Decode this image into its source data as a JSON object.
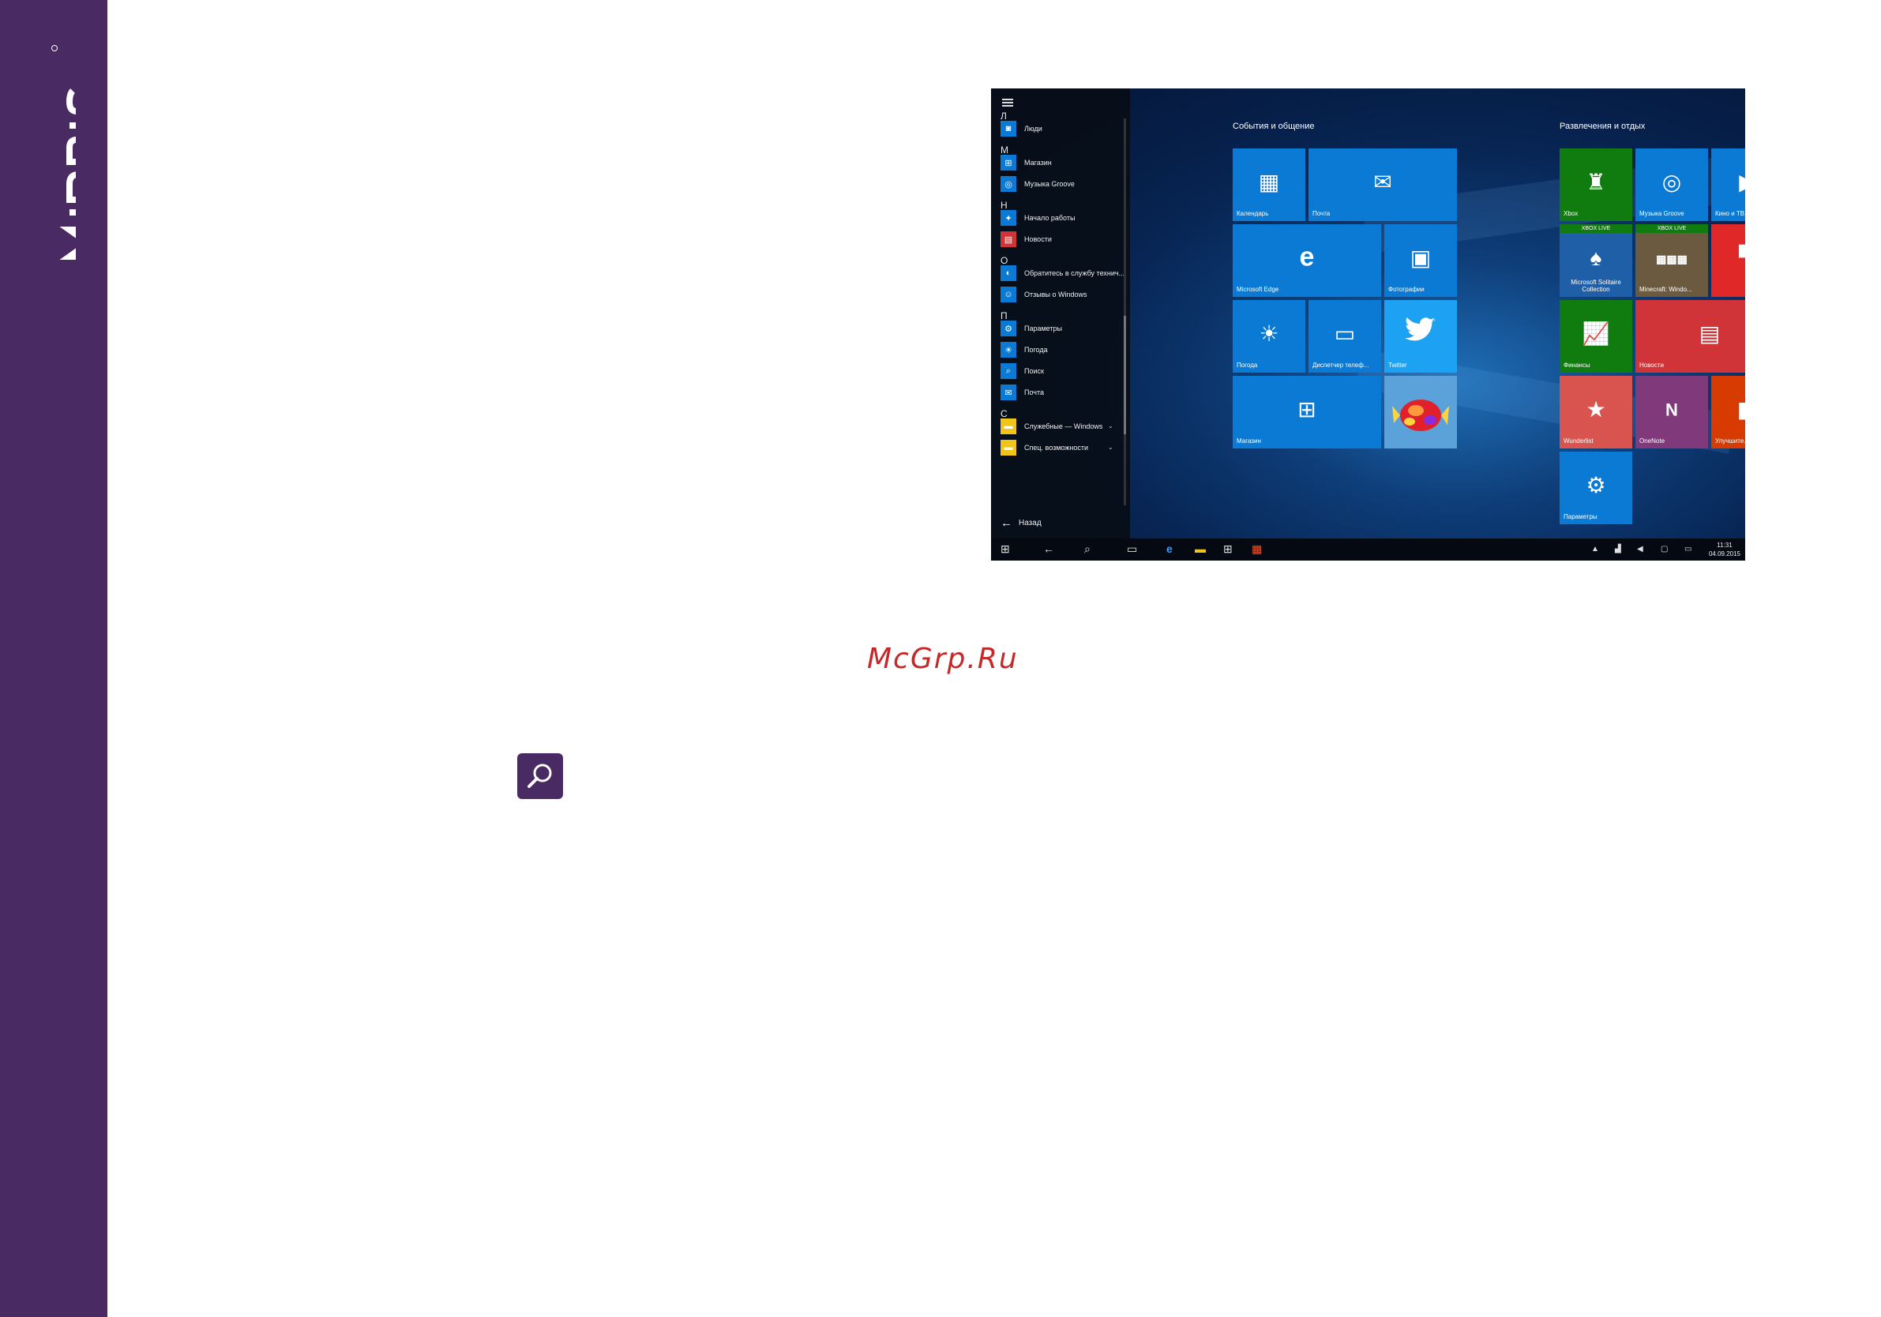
{
  "brand": {
    "name": "IRBIS",
    "color": "#4a2a63"
  },
  "start_menu": {
    "sections": [
      {
        "letter": "Л",
        "apps": [
          {
            "label": "Люди",
            "icon": "people-icon",
            "color": "#0a7ad4"
          }
        ]
      },
      {
        "letter": "М",
        "apps": [
          {
            "label": "Магазин",
            "icon": "store-icon",
            "color": "#0a7ad4"
          },
          {
            "label": "Музыка Groove",
            "icon": "groove-music-icon",
            "color": "#0a7ad4"
          }
        ]
      },
      {
        "letter": "Н",
        "apps": [
          {
            "label": "Начало работы",
            "icon": "get-started-icon",
            "color": "#0a7ad4"
          },
          {
            "label": "Новости",
            "icon": "news-icon",
            "color": "#d13438"
          }
        ]
      },
      {
        "letter": "О",
        "apps": [
          {
            "label": "Обратитесь в службу технич...",
            "icon": "contact-support-icon",
            "color": "#0a7ad4"
          },
          {
            "label": "Отзывы о Windows",
            "icon": "feedback-icon",
            "color": "#0a7ad4"
          }
        ]
      },
      {
        "letter": "П",
        "apps": [
          {
            "label": "Параметры",
            "icon": "settings-icon",
            "color": "#0a7ad4"
          },
          {
            "label": "Погода",
            "icon": "weather-icon",
            "color": "#0a7ad4"
          },
          {
            "label": "Поиск",
            "icon": "search-icon",
            "color": "#0a7ad4"
          },
          {
            "label": "Почта",
            "icon": "mail-icon",
            "color": "#0a7ad4"
          }
        ]
      },
      {
        "letter": "С",
        "apps": [
          {
            "label": "Служебные — Windows",
            "icon": "folder-icon",
            "color": "#f0c419",
            "expandable": true
          },
          {
            "label": "Спец. возможности",
            "icon": "folder-icon",
            "color": "#f0c419",
            "expandable": true
          }
        ]
      }
    ],
    "back_label": "Назад"
  },
  "groups": [
    {
      "title": "События и общение"
    },
    {
      "title": "Развлечения и отдых"
    }
  ],
  "tiles": {
    "calendar": {
      "label": "Календарь",
      "icon": "calendar-icon",
      "color": "#0a7ad4"
    },
    "mail": {
      "label": "Почта",
      "icon": "mail-icon",
      "color": "#0a7ad4"
    },
    "edge": {
      "label": "Microsoft Edge",
      "icon": "edge-icon",
      "color": "#0a7ad4"
    },
    "photos": {
      "label": "Фотографии",
      "icon": "photos-icon",
      "color": "#0a7ad4"
    },
    "weather": {
      "label": "Погода",
      "icon": "weather-icon",
      "color": "#0a7ad4"
    },
    "phone": {
      "label": "Диспетчер телеф...",
      "icon": "phone-companion-icon",
      "color": "#0a7ad4"
    },
    "twitter": {
      "label": "Twitter",
      "icon": "twitter-icon",
      "color": "#1da1f2"
    },
    "store": {
      "label": "Магазин",
      "icon": "store-icon",
      "color": "#0a7ad4"
    },
    "candy": {
      "label": "",
      "icon": "candy-crush-icon",
      "color": "#5aa2d9"
    },
    "xbox": {
      "label": "Xbox",
      "icon": "xbox-icon",
      "color": "#107c10"
    },
    "groove": {
      "label": "Музыка Groove",
      "icon": "groove-music-icon",
      "color": "#0a7ad4"
    },
    "movies": {
      "label": "Кино и ТВ",
      "icon": "movies-icon",
      "color": "#0a7ad4"
    },
    "solitaire": {
      "label": "Microsoft Solitaire Collection",
      "badge": "XBOX LIVE",
      "icon": "solitaire-icon",
      "color": "#1e5fa8"
    },
    "minecraft": {
      "label": "Minecraft: Windo...",
      "badge": "XBOX LIVE",
      "icon": "minecraft-icon",
      "color": "#6b5a40"
    },
    "flipboard": {
      "label": "",
      "icon": "flipboard-icon",
      "color": "#e12828"
    },
    "finance": {
      "label": "Финансы",
      "icon": "finance-icon",
      "color": "#107c10"
    },
    "news": {
      "label": "Новости",
      "icon": "news-icon",
      "color": "#d13438"
    },
    "wunderlist": {
      "label": "Wunderlist",
      "icon": "wunderlist-icon",
      "color": "#d9544f"
    },
    "onenote": {
      "label": "OneNote",
      "icon": "onenote-icon",
      "color": "#80397b"
    },
    "office": {
      "label": "Улучшите...",
      "icon": "office-icon",
      "color": "#d83b01"
    },
    "settings": {
      "label": "Параметры",
      "icon": "settings-icon",
      "color": "#0a7ad4"
    }
  },
  "taskbar": {
    "time": "11:31",
    "date": "04.09.2015"
  },
  "watermark": "McGrp.Ru"
}
